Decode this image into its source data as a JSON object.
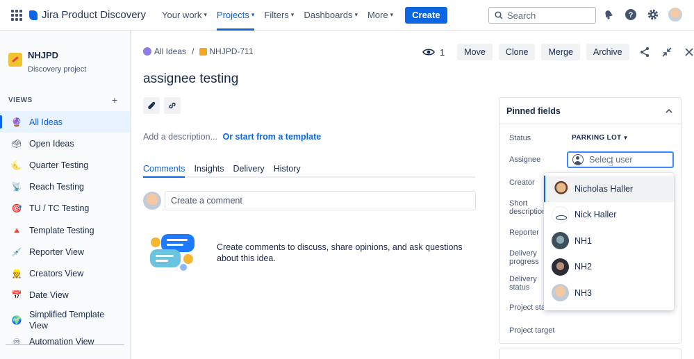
{
  "topnav": {
    "product": "Jira Product Discovery",
    "items": [
      {
        "label": "Your work",
        "active": false
      },
      {
        "label": "Projects",
        "active": true
      },
      {
        "label": "Filters",
        "active": false
      },
      {
        "label": "Dashboards",
        "active": false
      },
      {
        "label": "More",
        "active": false
      }
    ],
    "create_label": "Create",
    "search_placeholder": "Search",
    "icons": [
      "notifications-icon",
      "help-icon",
      "settings-icon",
      "avatar"
    ]
  },
  "sidebar": {
    "project_name": "NHJPD",
    "project_type": "Discovery project",
    "views_label": "VIEWS",
    "views_add": "+",
    "items": [
      {
        "label": "All Ideas",
        "icon": "🔮",
        "active": true
      },
      {
        "label": "Open Ideas",
        "icon": "🗳"
      },
      {
        "label": "Quarter Testing",
        "icon": "🌜"
      },
      {
        "label": "Reach Testing",
        "icon": "📡"
      },
      {
        "label": "TU / TC Testing",
        "icon": "🎯"
      },
      {
        "label": "Template Testing",
        "icon": "🔺"
      },
      {
        "label": "Reporter View",
        "icon": "💉"
      },
      {
        "label": "Creators View",
        "icon": "👷"
      },
      {
        "label": "Date View",
        "icon": "📅"
      },
      {
        "label": "Simplified Template View",
        "icon": "🌍"
      },
      {
        "label": "Automation View",
        "icon": "♾"
      }
    ]
  },
  "breadcrumbs": {
    "parent": "All Ideas",
    "separator": "/",
    "issue_key": "NHJPD-711"
  },
  "actions": {
    "watch_count": "1",
    "move": "Move",
    "clone": "Clone",
    "merge": "Merge",
    "archive": "Archive"
  },
  "issue": {
    "title": "assignee testing",
    "description_placeholder": "Add a description...",
    "template_link": "Or start from a template"
  },
  "tabs": [
    {
      "label": "Comments",
      "active": true
    },
    {
      "label": "Insights"
    },
    {
      "label": "Delivery"
    },
    {
      "label": "History"
    }
  ],
  "comments": {
    "placeholder": "Create a comment",
    "empty_text": "Create comments to discuss, share opinions, and ask questions about this idea."
  },
  "pinned": {
    "title": "Pinned fields",
    "fields": [
      "Status",
      "Assignee",
      "Creator",
      "Short description",
      "Reporter",
      "Delivery progress",
      "Delivery status",
      "Project start",
      "Project target"
    ],
    "status_value": "PARKING LOT",
    "assignee_placeholder": "Select user"
  },
  "user_options": [
    {
      "name": "Nicholas Haller",
      "hover": true
    },
    {
      "name": "Nick Haller"
    },
    {
      "name": "NH1"
    },
    {
      "name": "NH2"
    },
    {
      "name": "NH3"
    }
  ],
  "colors": {
    "accent": "#0c66e4",
    "focus": "#388bff"
  }
}
